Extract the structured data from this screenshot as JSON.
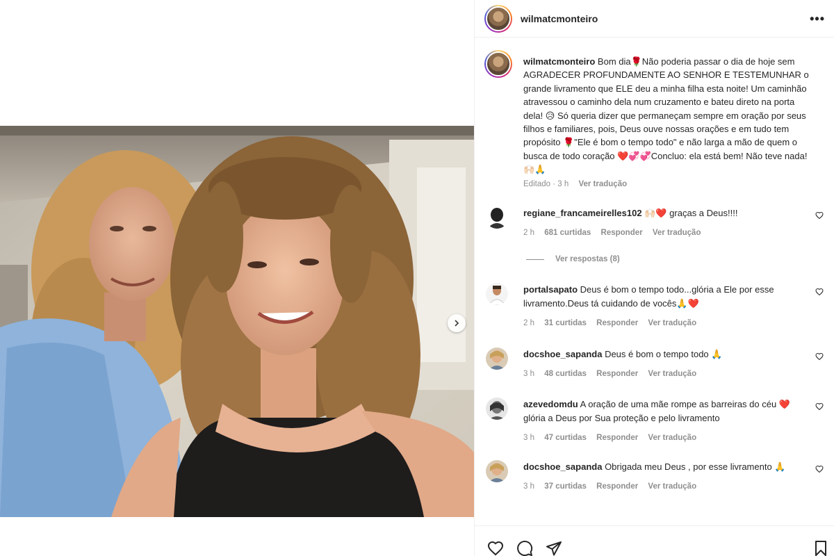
{
  "post": {
    "username": "wilmatcmonteiro",
    "more_icon": "more-horizontal-icon",
    "caption": {
      "username": "wilmatcmonteiro",
      "text": "Bom dia🌹Não poderia passar o dia de hoje sem AGRADECER PROFUNDAMENTE AO SENHOR E TESTEMUNHAR o grande livramento que ELE deu a minha filha esta noite! Um caminhão atravessou o caminho dela num cruzamento e bateu direto na porta dela! 😥 Só queria dizer que permaneçam sempre em oração por seus filhos e familiares, pois, Deus ouve nossas orações e em tudo tem propósito 🌹\"Ele é bom o tempo todo\" e não larga a mão de quem o busca de todo coração ❤️💞💞Concluo: ela está bem! Não teve nada!🙌🏻🙏",
      "edited_label": "Editado",
      "time": "3 h",
      "translate_label": "Ver tradução"
    }
  },
  "comments": [
    {
      "username": "regiane_francameirelles102",
      "text": "🙌🏻❤️ graças a Deus!!!!",
      "time": "2 h",
      "likes": "681 curtidas",
      "reply_label": "Responder",
      "translate_label": "Ver tradução",
      "view_replies": "Ver respostas (8)"
    },
    {
      "username": "portalsapato",
      "text": "Deus é bom o tempo todo...glória a Ele por esse livramento.Deus tá cuidando de vocês🙏❤️",
      "time": "2 h",
      "likes": "31 curtidas",
      "reply_label": "Responder",
      "translate_label": "Ver tradução"
    },
    {
      "username": "docshoe_sapanda",
      "text": "Deus é bom o tempo todo 🙏",
      "time": "3 h",
      "likes": "48 curtidas",
      "reply_label": "Responder",
      "translate_label": "Ver tradução"
    },
    {
      "username": "azevedomdu",
      "text": "A oração de uma mãe rompe as barreiras do céu ❤️ glória a Deus por Sua proteção e pelo livramento",
      "time": "3 h",
      "likes": "47 curtidas",
      "reply_label": "Responder",
      "translate_label": "Ver tradução"
    },
    {
      "username": "docshoe_sapanda",
      "text": "Obrigada meu Deus , por esse livramento 🙏",
      "time": "3 h",
      "likes": "37 curtidas",
      "reply_label": "Responder",
      "translate_label": "Ver tradução"
    }
  ],
  "actions": {
    "like_icon": "heart-icon",
    "comment_icon": "comment-icon",
    "share_icon": "share-icon",
    "save_icon": "bookmark-icon"
  },
  "media": {
    "next_icon": "chevron-right-icon"
  },
  "colors": {
    "text": "#262626",
    "secondary_text": "#8e8e8e",
    "border": "#efefef",
    "heart_red": "#e0245e"
  }
}
